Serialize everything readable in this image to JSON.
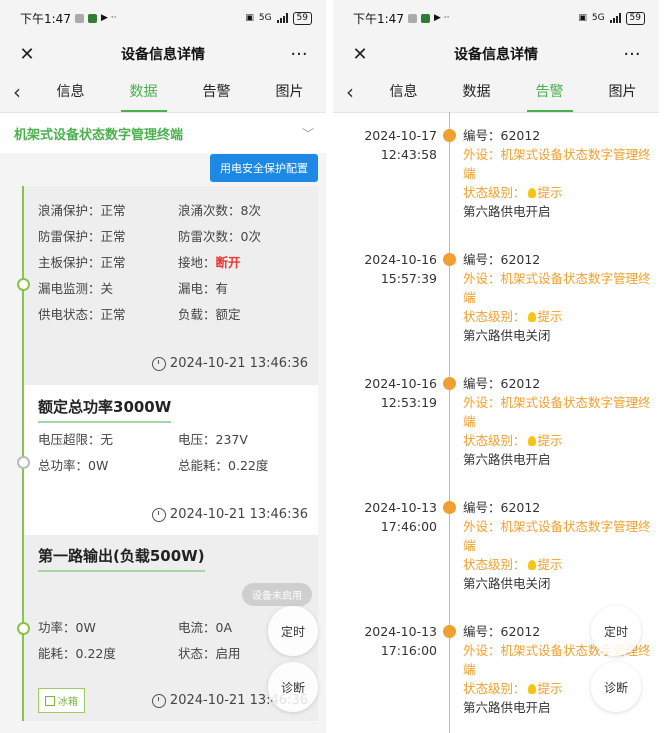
{
  "status": {
    "time": "下午1:47",
    "net": "5G",
    "battery": "59"
  },
  "header": {
    "title": "设备信息详情",
    "close": "✕",
    "more": "···"
  },
  "tabs": [
    {
      "label": "信息"
    },
    {
      "label": "数据"
    },
    {
      "label": "告警"
    },
    {
      "label": "图片"
    }
  ],
  "left": {
    "device_name": "机架式设备状态数字管理终端",
    "config_button": "用电安全保护配置",
    "card1": {
      "rows": [
        [
          "浪涌保护：",
          "正常",
          "浪涌次数：",
          "8次"
        ],
        [
          "防雷保护：",
          "正常",
          "防雷次数：",
          "0次"
        ],
        [
          "主板保护：",
          "正常",
          "接地：",
          "断开"
        ],
        [
          "漏电监测：",
          "关",
          "漏电：",
          "有"
        ],
        [
          "供电状态：",
          "正常",
          "负载：",
          "额定"
        ]
      ],
      "timestamp": "2024-10-21 13:46:36"
    },
    "card2": {
      "title": "额定总功率3000W",
      "rows": [
        [
          "电压超限：",
          "无",
          "电压：",
          "237V"
        ],
        [
          "总功率：",
          "0W",
          "总能耗：",
          "0.22度"
        ]
      ],
      "timestamp": "2024-10-21 13:46:36"
    },
    "card3": {
      "title": "第一路输出(负载500W)",
      "badge": "设备未启用",
      "rows": [
        [
          "功率：",
          "0W",
          "电流：",
          "0A"
        ],
        [
          "能耗：",
          "0.22度",
          "状态：",
          "启用"
        ]
      ],
      "tag": "冰箱",
      "timestamp": "2024-10-21 13:46:36"
    },
    "fab_timer": "定时",
    "fab_diag": "诊断"
  },
  "right": {
    "events": [
      {
        "date": "2024-10-17",
        "time": "12:43:58",
        "id": "编号：62012",
        "device": "外设：机架式设备状态数字管理终端",
        "level_label": "状态级别：",
        "level": "提示",
        "desc": "第六路供电开启"
      },
      {
        "date": "2024-10-16",
        "time": "15:57:39",
        "id": "编号：62012",
        "device": "外设：机架式设备状态数字管理终端",
        "level_label": "状态级别：",
        "level": "提示",
        "desc": "第六路供电关闭"
      },
      {
        "date": "2024-10-16",
        "time": "12:53:19",
        "id": "编号：62012",
        "device": "外设：机架式设备状态数字管理终端",
        "level_label": "状态级别：",
        "level": "提示",
        "desc": "第六路供电开启"
      },
      {
        "date": "2024-10-13",
        "time": "17:46:00",
        "id": "编号：62012",
        "device": "外设：机架式设备状态数字管理终端",
        "level_label": "状态级别：",
        "level": "提示",
        "desc": "第六路供电关闭"
      },
      {
        "date": "2024-10-13",
        "time": "17:16:00",
        "id": "编号：62012",
        "device": "外设：机架式设备状态数字管理终端",
        "level_label": "状态级别：",
        "level": "提示",
        "desc": "第六路供电开启"
      }
    ],
    "fab_timer": "定时",
    "fab_diag": "诊断"
  },
  "colors": {
    "accent": "#4caf50",
    "warn": "#f0a030",
    "danger": "#e53935",
    "primary": "#1e88e5"
  }
}
